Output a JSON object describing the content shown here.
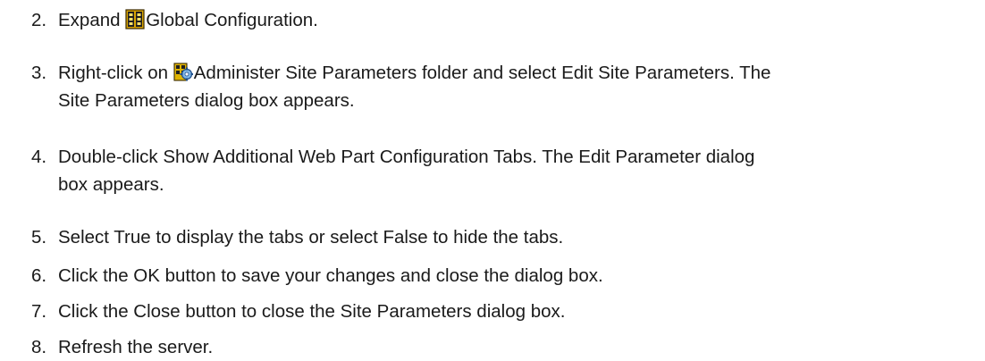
{
  "steps": [
    {
      "number": "2.",
      "before": "Expand ",
      "icon": "global-configuration-icon",
      "after": "Global Configuration."
    },
    {
      "number": "3.",
      "before": "Right-click on ",
      "icon": "administer-site-parameters-icon",
      "after_line1": "Administer Site Parameters folder and select Edit Site Parameters. The",
      "after_line2": "Site Parameters dialog box appears."
    },
    {
      "number": "4.",
      "line1": "Double-click Show Additional Web Part Configuration Tabs. The Edit Parameter dialog",
      "line2": "box appears."
    },
    {
      "number": "5.",
      "text": "Select True to display the tabs or select False to hide the tabs."
    },
    {
      "number": "6.",
      "text": "Click the OK button to save your changes and close the dialog box."
    },
    {
      "number": "7.",
      "text": "Click the Close button to close the Site Parameters dialog box."
    },
    {
      "number": "8.",
      "text": "Refresh the server."
    }
  ]
}
